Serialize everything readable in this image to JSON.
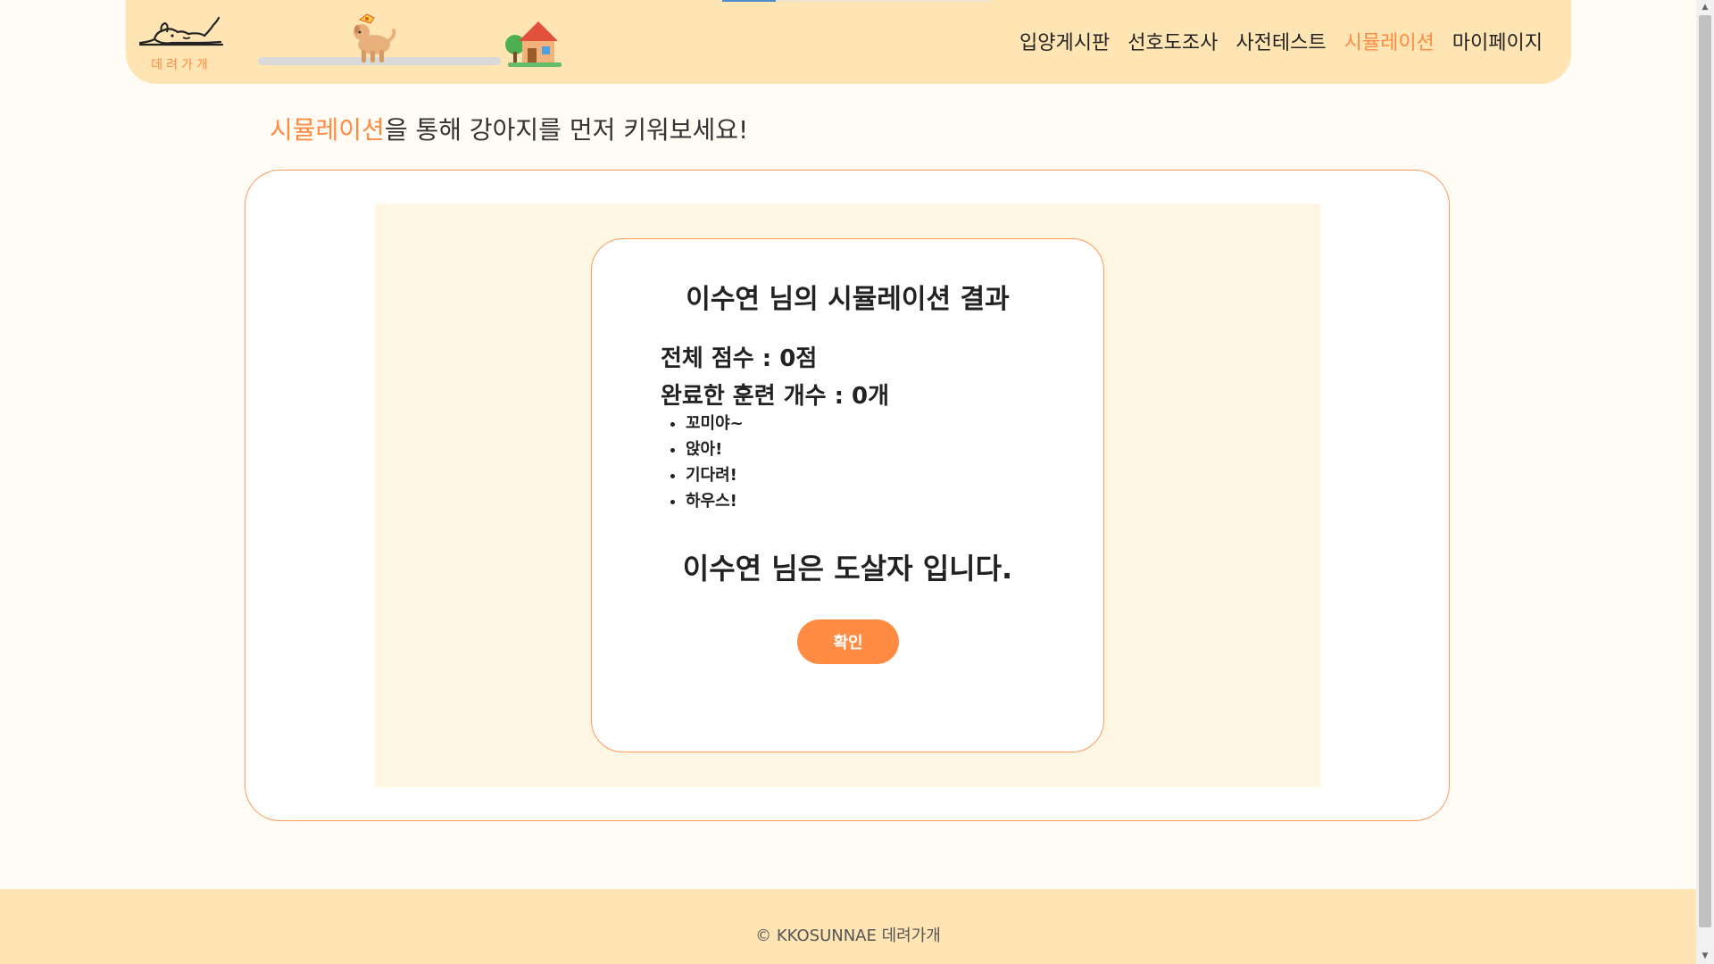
{
  "header": {
    "logo_text": "데려가개",
    "progress": {
      "value_percent": 45
    },
    "nav": [
      {
        "label": "입양게시판",
        "active": false
      },
      {
        "label": "선호도조사",
        "active": false
      },
      {
        "label": "사전테스트",
        "active": false
      },
      {
        "label": "시뮬레이션",
        "active": true
      },
      {
        "label": "마이페이지",
        "active": false
      }
    ]
  },
  "page": {
    "title_highlight": "시뮬레이션",
    "title_rest": "을 통해 강아지를 먼저 키워보세요!"
  },
  "result": {
    "title": "이수연 님의 시뮬레이션 결과",
    "total_score": "전체 점수 : 0점",
    "completed_count": "완료한 훈련 개수 : 0개",
    "trainings": [
      "꼬미야~",
      "앉아!",
      "기다려!",
      "하우스!"
    ],
    "verdict": "이수연 님은 도살자 입니다.",
    "confirm_label": "확인"
  },
  "footer": {
    "copyright": "© KKOSUNNAE 데려가개"
  },
  "colors": {
    "accent": "#ff8c42",
    "header_bg": "#ffe4b4",
    "sim_bg": "#fff6e4",
    "page_bg": "#fffbf5"
  },
  "icons": {
    "logo": "sleeping-dog-icon",
    "progress_marker": "dog-icon",
    "progress_goal": "house-icon"
  }
}
